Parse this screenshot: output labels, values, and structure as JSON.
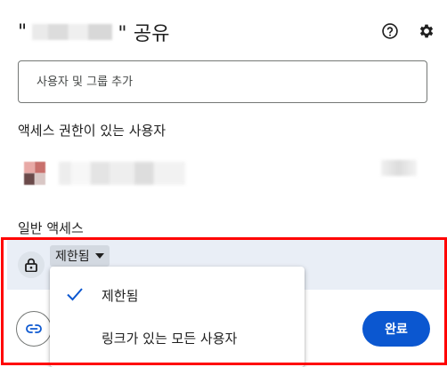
{
  "dialog": {
    "title_prefix": "\"",
    "title_suffix": "\" 공유",
    "help_icon": "help-circle-icon",
    "settings_icon": "gear-icon"
  },
  "add_people": {
    "placeholder": "사용자 및 그룹 추가"
  },
  "people_with_access": {
    "heading": "액세스 권한이 있는 사용자"
  },
  "general_access": {
    "heading": "일반 액세스",
    "selected": "제한됨",
    "icon": "lock-icon"
  },
  "menu": {
    "items": [
      {
        "label": "제한됨",
        "checked": true
      },
      {
        "label": "링크가 있는 모든 사용자",
        "checked": false
      }
    ]
  },
  "footer": {
    "copy_link_icon": "link-icon",
    "done_label": "완료"
  },
  "colors": {
    "accent": "#0b57d0",
    "access_band": "#e9eef6",
    "highlight": "#ff0000",
    "check": "#0b57d0"
  }
}
